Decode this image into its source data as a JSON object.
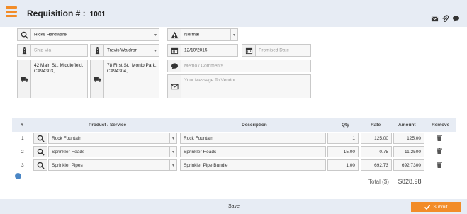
{
  "header": {
    "title": "Requisition # :",
    "number": "1001"
  },
  "vendor": {
    "name": "Hicks Hardware",
    "ship_via_placeholder": "Ship Via",
    "address": "42 Main St., Middlefield, CA94303,"
  },
  "employee": {
    "name": "Travis Waldron",
    "address": "78 First St., Monlo Park, CA94304,"
  },
  "priority": {
    "value": "Normal"
  },
  "dates": {
    "date": "12/10/2015",
    "promised_placeholder": "Promised Date"
  },
  "memo": {
    "placeholder": "Memo / Comments"
  },
  "message": {
    "placeholder": "Your Message To Vendor"
  },
  "table": {
    "headers": {
      "num": "#",
      "product": "Product / Service",
      "description": "Description",
      "qty": "Qty",
      "rate": "Rate",
      "amount": "Amount",
      "remove": "Remove"
    },
    "rows": [
      {
        "num": "1",
        "product": "Rock Fountain",
        "description": "Rock Fountain",
        "qty": "1",
        "rate": "125.00",
        "amount": "125.00"
      },
      {
        "num": "2",
        "product": "Sprinkler Heads",
        "description": "Sprinkler Heads",
        "qty": "15.00",
        "rate": "0.75",
        "amount": "11.2500"
      },
      {
        "num": "3",
        "product": "Sprinkler Pipes",
        "description": "Sprinkler Pipe Bundle",
        "qty": "1.00",
        "rate": "692.73",
        "amount": "692.7300"
      }
    ]
  },
  "total": {
    "label": "Total ($)",
    "value": "$828.98"
  },
  "footer": {
    "save": "Save",
    "submit": "Submit"
  },
  "colors": {
    "accent": "#f28c28",
    "header_bg": "#e7ecf4",
    "add_button": "#4a86c5"
  }
}
